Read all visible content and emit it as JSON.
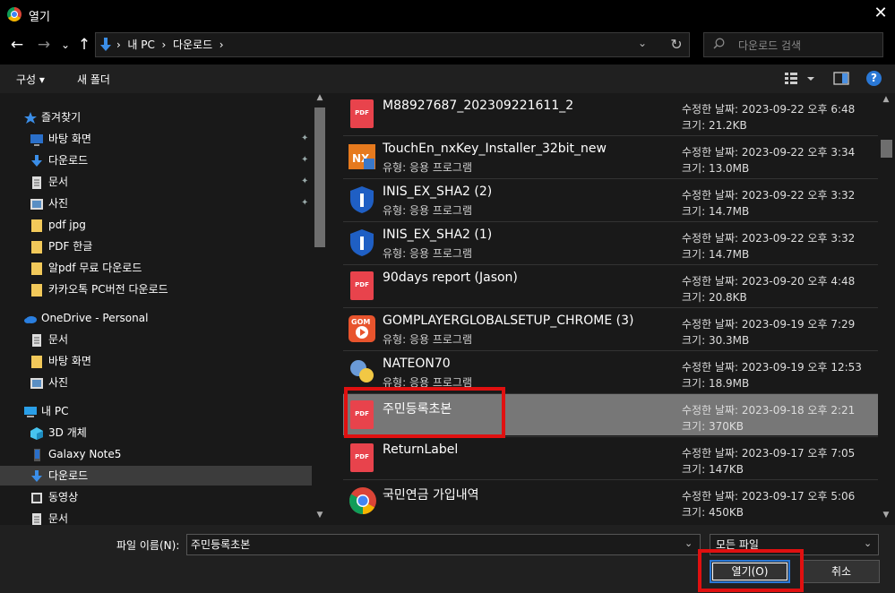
{
  "window": {
    "title": "열기",
    "close_glyph": "✕"
  },
  "nav": {
    "back": "←",
    "forward": "→",
    "recent": "⌄",
    "up": "↑",
    "path_text": "›  내 PC  ›  다운로드  ›",
    "dropdown": "⌄",
    "refresh": "↻",
    "search_placeholder": "다운로드 검색"
  },
  "toolbar": {
    "organize": "구성 ▾",
    "new_folder": "새 폴더",
    "help": "?"
  },
  "sidebar": {
    "items": [
      {
        "label": "즐겨찾기",
        "icon": "star-icon",
        "indent": 0,
        "pin": false
      },
      {
        "label": "바탕 화면",
        "icon": "desktop-icon",
        "indent": 1,
        "pin": true
      },
      {
        "label": "다운로드",
        "icon": "download-icon",
        "indent": 1,
        "pin": true
      },
      {
        "label": "문서",
        "icon": "document-icon",
        "indent": 1,
        "pin": true
      },
      {
        "label": "사진",
        "icon": "picture-icon",
        "indent": 1,
        "pin": true
      },
      {
        "label": "pdf jpg",
        "icon": "folder-icon",
        "indent": 1,
        "pin": false
      },
      {
        "label": "PDF 한글",
        "icon": "folder-icon",
        "indent": 1,
        "pin": false
      },
      {
        "label": "알pdf 무료 다운로드",
        "icon": "folder-icon",
        "indent": 1,
        "pin": false
      },
      {
        "label": "카카오톡 PC버전 다운로드",
        "icon": "folder-icon",
        "indent": 1,
        "pin": false
      },
      {
        "label": "OneDrive - Personal",
        "icon": "cloud-icon",
        "indent": 0,
        "pin": false
      },
      {
        "label": "문서",
        "icon": "document-icon",
        "indent": 1,
        "pin": false
      },
      {
        "label": "바탕 화면",
        "icon": "folder-icon",
        "indent": 1,
        "pin": false
      },
      {
        "label": "사진",
        "icon": "picture-icon",
        "indent": 1,
        "pin": false
      },
      {
        "label": "내 PC",
        "icon": "computer-icon",
        "indent": 0,
        "pin": false
      },
      {
        "label": "3D 개체",
        "icon": "cube-icon",
        "indent": 1,
        "pin": false
      },
      {
        "label": "Galaxy Note5",
        "icon": "phone-icon",
        "indent": 1,
        "pin": false
      },
      {
        "label": "다운로드",
        "icon": "download-icon",
        "indent": 1,
        "pin": false,
        "selected": true
      },
      {
        "label": "동영상",
        "icon": "video-icon",
        "indent": 1,
        "pin": false
      },
      {
        "label": "문서",
        "icon": "document-icon",
        "indent": 1,
        "pin": false
      }
    ]
  },
  "files": [
    {
      "name": "M88927687_202309221611_2",
      "meta": "",
      "date": "수정한 날짜: 2023-09-22 오후 6:48",
      "size": "크기: 21.2KB",
      "icon": "pdf-icon"
    },
    {
      "name": "TouchEn_nxKey_Installer_32bit_new",
      "meta": "유형: 응용 프로그램",
      "date": "수정한 날짜: 2023-09-22 오후 3:34",
      "size": "크기: 13.0MB",
      "icon": "nx-installer-icon"
    },
    {
      "name": "INIS_EX_SHA2 (2)",
      "meta": "유형: 응용 프로그램",
      "date": "수정한 날짜: 2023-09-22 오후 3:32",
      "size": "크기: 14.7MB",
      "icon": "shield-icon"
    },
    {
      "name": "INIS_EX_SHA2 (1)",
      "meta": "유형: 응용 프로그램",
      "date": "수정한 날짜: 2023-09-22 오후 3:32",
      "size": "크기: 14.7MB",
      "icon": "shield-icon"
    },
    {
      "name": "90days report (Jason)",
      "meta": "",
      "date": "수정한 날짜: 2023-09-20 오후 4:48",
      "size": "크기: 20.8KB",
      "icon": "pdf-icon"
    },
    {
      "name": "GOMPLAYERGLOBALSETUP_CHROME (3)",
      "meta": "유형: 응용 프로그램",
      "date": "수정한 날짜: 2023-09-19 오후 7:29",
      "size": "크기: 30.3MB",
      "icon": "gom-icon"
    },
    {
      "name": "NATEON70",
      "meta": "유형: 응용 프로그램",
      "date": "수정한 날짜: 2023-09-19 오후 12:53",
      "size": "크기: 18.9MB",
      "icon": "nateon-icon"
    },
    {
      "name": "주민등록초본",
      "meta": "",
      "date": "수정한 날짜: 2023-09-18 오후 2:21",
      "size": "크기: 370KB",
      "icon": "pdf-icon",
      "selected": true
    },
    {
      "name": "ReturnLabel",
      "meta": "",
      "date": "수정한 날짜: 2023-09-17 오후 7:05",
      "size": "크기: 147KB",
      "icon": "pdf-icon"
    },
    {
      "name": "국민연금 가입내역",
      "meta": "",
      "date": "수정한 날짜: 2023-09-17 오후 5:06",
      "size": "크기: 450KB",
      "icon": "chrome-icon"
    }
  ],
  "bottom": {
    "filename_label": "파일 이름(N):",
    "filename_value": "주민등록초본",
    "filter": "모든 파일",
    "open": "열기(O)",
    "cancel": "취소"
  },
  "pdf_label": "PDF"
}
